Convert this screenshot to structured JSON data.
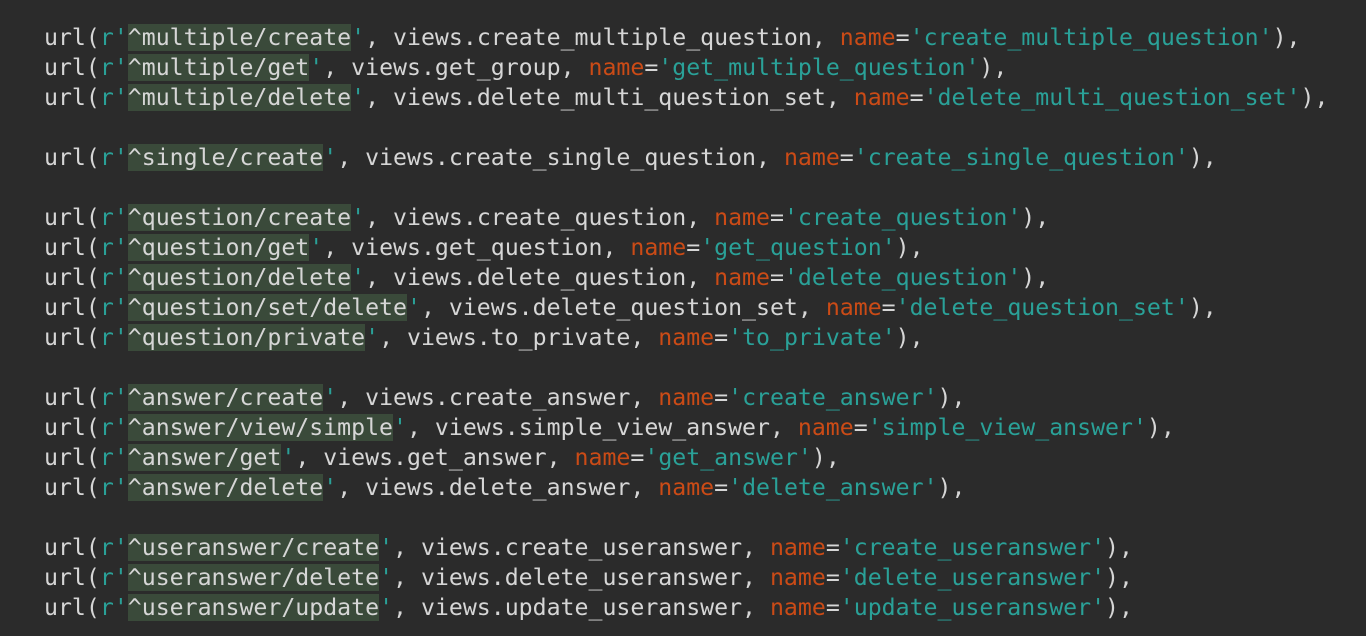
{
  "editor": {
    "colors": {
      "background": "#2b2b2b",
      "text": "#d6d6d6",
      "string": "#2aa198",
      "keyword": "#cb4b16",
      "regex_highlight": "#3a4a3a"
    },
    "tokens": {
      "fn": "url(",
      "prefix": "r",
      "quote": "'",
      "comma": ", ",
      "views_prefix": "views.",
      "kw": "name",
      "eq": "=",
      "close": "),"
    },
    "groups": [
      {
        "lines": [
          {
            "regex": "^multiple/create",
            "view": "create_multiple_question",
            "name": "create_multiple_question"
          },
          {
            "regex": "^multiple/get",
            "view": "get_group",
            "name": "get_multiple_question"
          },
          {
            "regex": "^multiple/delete",
            "view": "delete_multi_question_set",
            "name": "delete_multi_question_set"
          }
        ]
      },
      {
        "lines": [
          {
            "regex": "^single/create",
            "view": "create_single_question",
            "name": "create_single_question"
          }
        ]
      },
      {
        "lines": [
          {
            "regex": "^question/create",
            "view": "create_question",
            "name": "create_question"
          },
          {
            "regex": "^question/get",
            "view": "get_question",
            "name": "get_question"
          },
          {
            "regex": "^question/delete",
            "view": "delete_question",
            "name": "delete_question"
          },
          {
            "regex": "^question/set/delete",
            "view": "delete_question_set",
            "name": "delete_question_set"
          },
          {
            "regex": "^question/private",
            "view": "to_private",
            "name": "to_private"
          }
        ]
      },
      {
        "lines": [
          {
            "regex": "^answer/create",
            "view": "create_answer",
            "name": "create_answer"
          },
          {
            "regex": "^answer/view/simple",
            "view": "simple_view_answer",
            "name": "simple_view_answer"
          },
          {
            "regex": "^answer/get",
            "view": "get_answer",
            "name": "get_answer"
          },
          {
            "regex": "^answer/delete",
            "view": "delete_answer",
            "name": "delete_answer"
          }
        ]
      },
      {
        "lines": [
          {
            "regex": "^useranswer/create",
            "view": "create_useranswer",
            "name": "create_useranswer"
          },
          {
            "regex": "^useranswer/delete",
            "view": "delete_useranswer",
            "name": "delete_useranswer"
          },
          {
            "regex": "^useranswer/update",
            "view": "update_useranswer",
            "name": "update_useranswer"
          }
        ]
      }
    ]
  }
}
